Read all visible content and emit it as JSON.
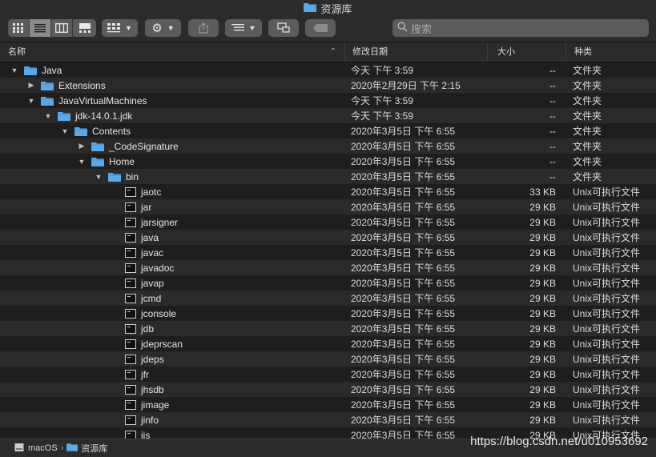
{
  "window": {
    "title": "资源库"
  },
  "search": {
    "placeholder": "搜索"
  },
  "columns": {
    "name": "名称",
    "date": "修改日期",
    "size": "大小",
    "kind": "种类"
  },
  "colors": {
    "folder": "#5aa9e6",
    "background": "#1e1e1e",
    "row_alt": "#2a2a2a"
  },
  "rows": [
    {
      "name": "Java",
      "date": "今天 下午 3:59",
      "size": "--",
      "kind": "文件夹",
      "type": "folder",
      "expanded": true,
      "depth": 0
    },
    {
      "name": "Extensions",
      "date": "2020年2月29日 下午 2:15",
      "size": "--",
      "kind": "文件夹",
      "type": "folder",
      "expanded": false,
      "depth": 1
    },
    {
      "name": "JavaVirtualMachines",
      "date": "今天 下午 3:59",
      "size": "--",
      "kind": "文件夹",
      "type": "folder",
      "expanded": true,
      "depth": 1
    },
    {
      "name": "jdk-14.0.1.jdk",
      "date": "今天 下午 3:59",
      "size": "--",
      "kind": "文件夹",
      "type": "folder",
      "expanded": true,
      "depth": 2
    },
    {
      "name": "Contents",
      "date": "2020年3月5日 下午 6:55",
      "size": "--",
      "kind": "文件夹",
      "type": "folder",
      "expanded": true,
      "depth": 3
    },
    {
      "name": "_CodeSignature",
      "date": "2020年3月5日 下午 6:55",
      "size": "--",
      "kind": "文件夹",
      "type": "folder",
      "expanded": false,
      "depth": 4
    },
    {
      "name": "Home",
      "date": "2020年3月5日 下午 6:55",
      "size": "--",
      "kind": "文件夹",
      "type": "folder",
      "expanded": true,
      "depth": 4
    },
    {
      "name": "bin",
      "date": "2020年3月5日 下午 6:55",
      "size": "--",
      "kind": "文件夹",
      "type": "folder",
      "expanded": true,
      "depth": 5
    },
    {
      "name": "jaotc",
      "date": "2020年3月5日 下午 6:55",
      "size": "33 KB",
      "kind": "Unix可执行文件",
      "type": "exec",
      "depth": 6
    },
    {
      "name": "jar",
      "date": "2020年3月5日 下午 6:55",
      "size": "29 KB",
      "kind": "Unix可执行文件",
      "type": "exec",
      "depth": 6
    },
    {
      "name": "jarsigner",
      "date": "2020年3月5日 下午 6:55",
      "size": "29 KB",
      "kind": "Unix可执行文件",
      "type": "exec",
      "depth": 6
    },
    {
      "name": "java",
      "date": "2020年3月5日 下午 6:55",
      "size": "29 KB",
      "kind": "Unix可执行文件",
      "type": "exec",
      "depth": 6
    },
    {
      "name": "javac",
      "date": "2020年3月5日 下午 6:55",
      "size": "29 KB",
      "kind": "Unix可执行文件",
      "type": "exec",
      "depth": 6
    },
    {
      "name": "javadoc",
      "date": "2020年3月5日 下午 6:55",
      "size": "29 KB",
      "kind": "Unix可执行文件",
      "type": "exec",
      "depth": 6
    },
    {
      "name": "javap",
      "date": "2020年3月5日 下午 6:55",
      "size": "29 KB",
      "kind": "Unix可执行文件",
      "type": "exec",
      "depth": 6
    },
    {
      "name": "jcmd",
      "date": "2020年3月5日 下午 6:55",
      "size": "29 KB",
      "kind": "Unix可执行文件",
      "type": "exec",
      "depth": 6
    },
    {
      "name": "jconsole",
      "date": "2020年3月5日 下午 6:55",
      "size": "29 KB",
      "kind": "Unix可执行文件",
      "type": "exec",
      "depth": 6
    },
    {
      "name": "jdb",
      "date": "2020年3月5日 下午 6:55",
      "size": "29 KB",
      "kind": "Unix可执行文件",
      "type": "exec",
      "depth": 6
    },
    {
      "name": "jdeprscan",
      "date": "2020年3月5日 下午 6:55",
      "size": "29 KB",
      "kind": "Unix可执行文件",
      "type": "exec",
      "depth": 6
    },
    {
      "name": "jdeps",
      "date": "2020年3月5日 下午 6:55",
      "size": "29 KB",
      "kind": "Unix可执行文件",
      "type": "exec",
      "depth": 6
    },
    {
      "name": "jfr",
      "date": "2020年3月5日 下午 6:55",
      "size": "29 KB",
      "kind": "Unix可执行文件",
      "type": "exec",
      "depth": 6
    },
    {
      "name": "jhsdb",
      "date": "2020年3月5日 下午 6:55",
      "size": "29 KB",
      "kind": "Unix可执行文件",
      "type": "exec",
      "depth": 6
    },
    {
      "name": "jimage",
      "date": "2020年3月5日 下午 6:55",
      "size": "29 KB",
      "kind": "Unix可执行文件",
      "type": "exec",
      "depth": 6
    },
    {
      "name": "jinfo",
      "date": "2020年3月5日 下午 6:55",
      "size": "29 KB",
      "kind": "Unix可执行文件",
      "type": "exec",
      "depth": 6
    },
    {
      "name": "jjs",
      "date": "2020年3月5日 下午 6:55",
      "size": "29 KB",
      "kind": "Unix可执行文件",
      "type": "exec",
      "depth": 6
    }
  ],
  "pathbar": {
    "items": [
      "macOS",
      "资源库"
    ]
  },
  "watermark": "https://blog.csdn.net/u010953692"
}
